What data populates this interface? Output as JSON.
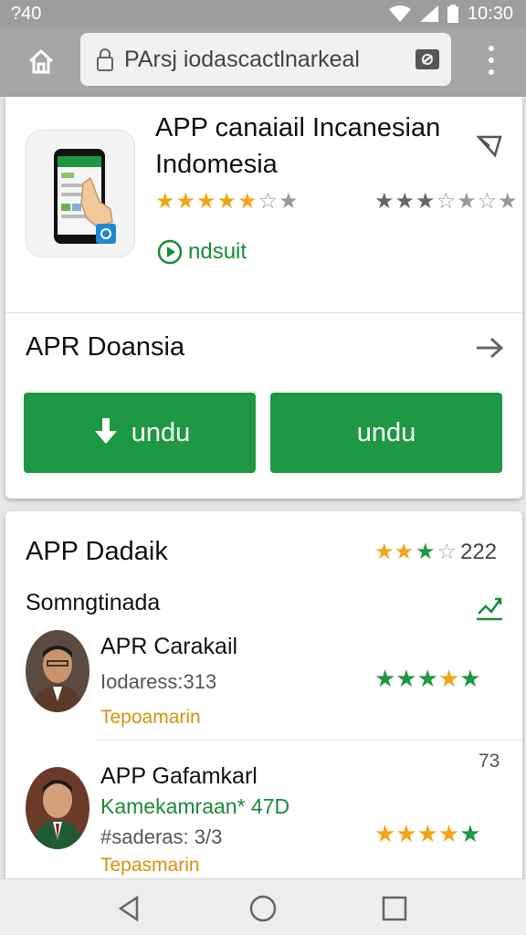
{
  "status_bar": {
    "time_left": "?40",
    "time_right": "10:30"
  },
  "browser": {
    "url": "PArsj iodascactlnarkeal"
  },
  "app": {
    "title": "APP саnаiail Incanesian Indomesia",
    "rating_stars": "★★★★★☆★",
    "rating_stars_alt": "★★★☆★☆★",
    "install_label": "ndsuit",
    "section_title": "APR Doansia",
    "button_left_label": "undu",
    "button_right_label": "undu"
  },
  "reviews_section": {
    "title": "APP Dadaik",
    "rating_stars": "★★★☆",
    "rating_count": "222",
    "subtitle": "Somngtinada",
    "reviews": [
      {
        "name": "APR Carakail",
        "meta": "Iodaress:313",
        "link": "Tepoamarin",
        "stars": "★★★★★"
      },
      {
        "name": "APP Gafamkarl",
        "handle": "Kamekamraan* 47D",
        "meta": "#saderas: 3/3",
        "link": "Tepasmarin",
        "stars": "★★★★★",
        "number": "73"
      }
    ]
  },
  "colors": {
    "accent_green": "#1e9843",
    "star_gold": "#f2a516",
    "star_green": "#1e9843",
    "link_gold": "#d4920c"
  },
  "icons": [
    "wifi-icon",
    "signal-icon",
    "battery-icon",
    "home-icon",
    "lock-icon",
    "tabs-icon",
    "more-vert-icon",
    "share-icon",
    "play-icon",
    "arrow-right-icon",
    "download-icon",
    "chart-icon",
    "back-icon",
    "home-circle-icon",
    "recents-icon"
  ]
}
